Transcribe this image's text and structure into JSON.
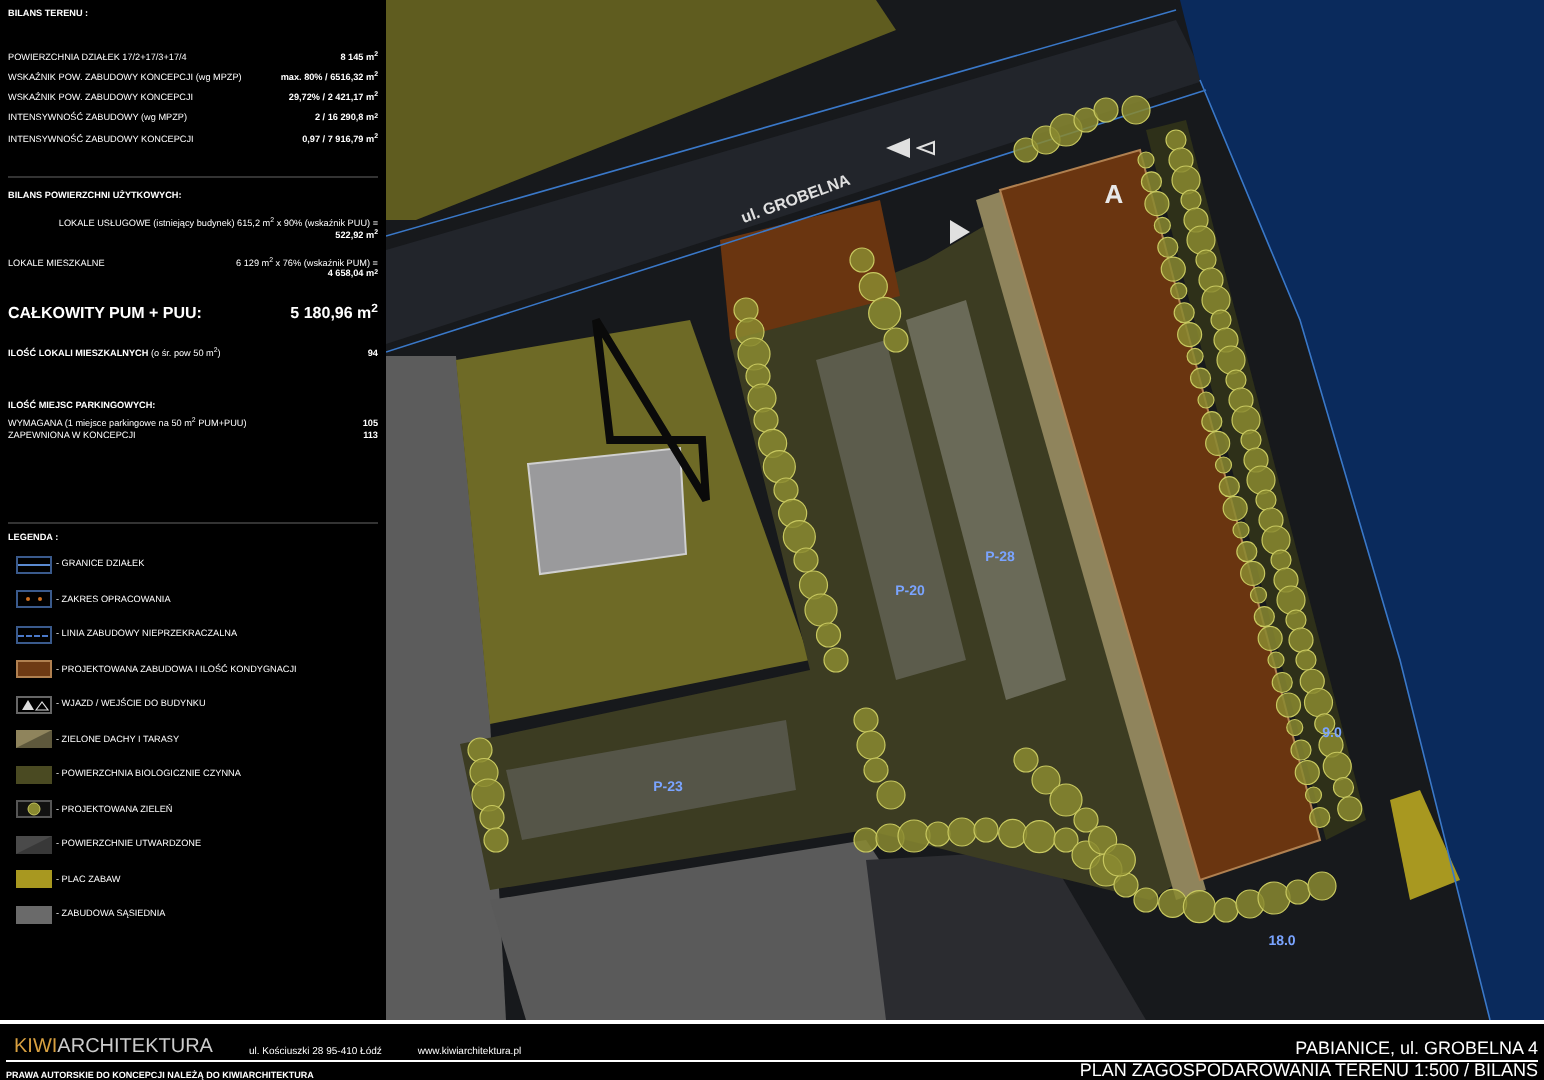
{
  "terrain_balance": {
    "title": "BILANS TERENU :",
    "rows": [
      {
        "label": "POWIERZCHNIA DZIAŁEK 17/2+17/3+17/4",
        "value": "8 145 m$^{2}$"
      },
      {
        "label": "WSKAŹNIK POW. ZABUDOWY KONCEPCJI (wg MPZP)",
        "value": "max. 80% / 6516,32 m$^{2}$"
      },
      {
        "label": "WSKAŹNIK POW. ZABUDOWY KONCEPCJI",
        "value": "29,72% / 2 421,17 m$^{2}$"
      },
      {
        "label": "INTENSYWNOŚĆ ZABUDOWY (wg MPZP)",
        "value": "2 / 16 290,8 m$^{2}$"
      },
      {
        "label": "INTENSYWNOŚĆ ZABUDOWY KONCEPCJI",
        "value": "0,97 / 7 916,79 m$^{2}$"
      }
    ]
  },
  "usable_area": {
    "title": "BILANS POWIERZCHNI UŻYTKOWYCH:",
    "rows": [
      {
        "label": "LOKALE USŁUGOWE (istniejący budynek) 615,2 m$^{2}$ x 90% (wskaźnik PUU) =",
        "value": "522,92 m$^{2}$"
      },
      {
        "label": "LOKALE MIESZKALNE",
        "detail": "6 129 m$^{2}$ x 76% (wskaźnik PUM) =",
        "value": "4 658,04 m$^{2}$"
      }
    ],
    "total_label": "CAŁKOWITY PUM + PUU:",
    "total_value": "5 180,96 m$^{2}$",
    "dwellings_label": "**ILOŚĆ LOKALI MIESZKALNYCH** (o śr. pow 50 m$^{2}$)",
    "dwellings_value": "94"
  },
  "parking": {
    "title": "ILOŚĆ MIEJSC PARKINGOWYCH:",
    "rows": [
      {
        "label": "WYMAGANA (1 miejsce parkingowe na 50 m$^{2}$ PUM+PUU)",
        "value": "105"
      },
      {
        "label": "ZAPEWNIONA W KONCEPCJI",
        "value": "113"
      }
    ]
  },
  "legend": {
    "title": "LEGENDA :",
    "items": [
      {
        "kind": "plot",
        "label": "- GRANICE DZIAŁEK"
      },
      {
        "kind": "scope",
        "label": "- ZAKRES OPRACOWANIA"
      },
      {
        "kind": "line",
        "label": "- LINIA ZABUDOWY NIEPRZEKRACZALNA"
      },
      {
        "kind": "building",
        "label": "- PROJEKTOWANA ZABUDOWA I ILOŚĆ KONDYGNACJI"
      },
      {
        "kind": "entry",
        "label": "- WJAZD / WEJŚCIE DO BUDYNKU"
      },
      {
        "kind": "roof",
        "label": "- ZIELONE DACHY I TARASY"
      },
      {
        "kind": "bio",
        "label": "- POWIERZCHNIA BIOLOGICZNIE CZYNNA"
      },
      {
        "kind": "tree",
        "label": "- PROJEKTOWANA ZIELEŃ"
      },
      {
        "kind": "paved",
        "label": "- POWIERZCHNIE UTWARDZONE"
      },
      {
        "kind": "play",
        "label": "- PLAC ZABAW"
      },
      {
        "kind": "neighbour",
        "label": "- ZABUDOWA SĄSIEDNIA"
      }
    ]
  },
  "plan": {
    "labels": [
      {
        "kind": "street",
        "text": "ul. GROBELNA"
      },
      {
        "kind": "building",
        "text": "A"
      },
      {
        "kind": "parking",
        "text": "P-28"
      },
      {
        "kind": "parking",
        "text": "P-20"
      },
      {
        "kind": "parking",
        "text": "P-23"
      },
      {
        "kind": "dimension",
        "text": "9.0"
      },
      {
        "kind": "dimension",
        "text": "18.0"
      }
    ]
  },
  "footer": {
    "logo_accent": "KIWI",
    "logo_rest": "ARCHITEKTURA",
    "address": "ul. Kościuszki 28 95-410 Łódź",
    "website": "www.kiwiarchitektura.pl",
    "copyright": "PRAWA AUTORSKIE DO KONCEPCJI NALEŻĄ DO KIWIARCHITEKTURA",
    "location": "PABIANICE, ul. GROBELNA 4",
    "sheet_title": "PLAN ZAGOSPODAROWANIA TERENU 1:500 / BILANS"
  }
}
